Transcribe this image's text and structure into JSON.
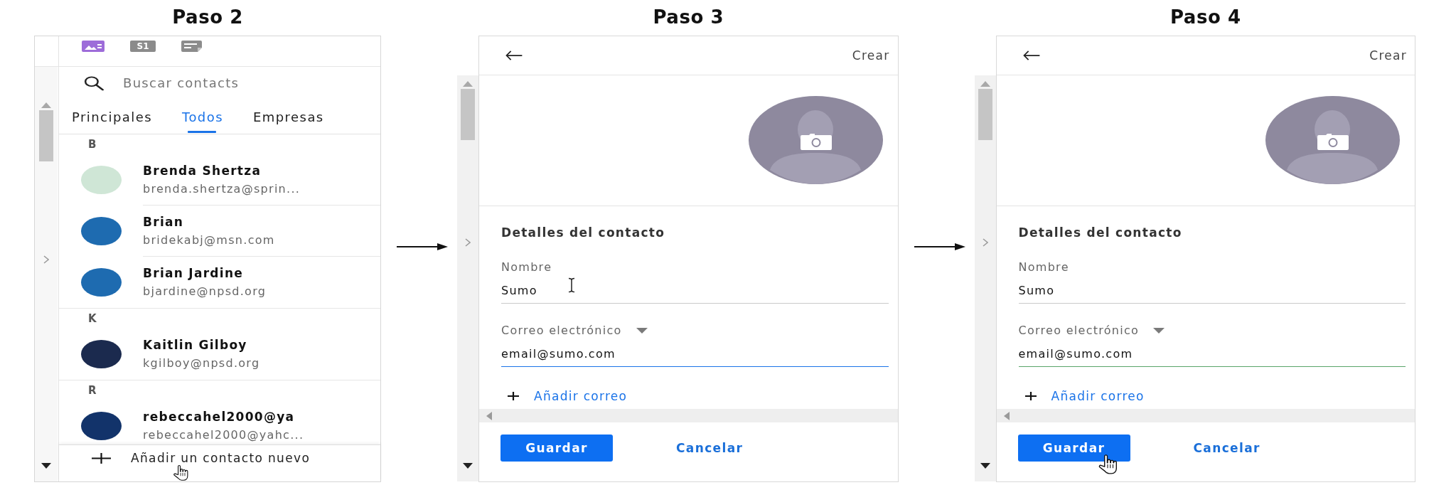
{
  "steps": [
    {
      "kind": "contacts",
      "title": "Paso 2",
      "toolbar": {
        "tile_label": "S1"
      },
      "search": {
        "placeholder": "Buscar contacts"
      },
      "tabs": [
        {
          "label": "Principales",
          "selected": false
        },
        {
          "label": "Todos",
          "selected": true
        },
        {
          "label": "Empresas",
          "selected": false
        }
      ],
      "groups": [
        {
          "letter": "B",
          "contacts": [
            {
              "name": "Brenda Shertza",
              "email": "brenda.shertza@sprin...",
              "color": "#cfe6d6"
            },
            {
              "name": "Brian",
              "email": "bridekabj@msn.com",
              "color": "#1e6bb0"
            },
            {
              "name": "Brian Jardine",
              "email": "bjardine@npsd.org",
              "color": "#1e6bb0"
            }
          ]
        },
        {
          "letter": "K",
          "contacts": [
            {
              "name": "Kaitlin Gilboy",
              "email": "kgilboy@npsd.org",
              "color": "#1b2a4e"
            }
          ]
        },
        {
          "letter": "R",
          "contacts": [
            {
              "name": "rebeccahel2000@ya",
              "email": "rebeccahel2000@yahc...",
              "color": "#12336a"
            }
          ]
        }
      ],
      "add_contact": {
        "label": "Añadir un contacto nuevo",
        "hovered": true
      }
    },
    {
      "kind": "form",
      "title": "Paso 3",
      "header_title": "Crear",
      "section_title": "Detalles del contacto",
      "fields": [
        {
          "kind": "text",
          "label": "Nombre",
          "value": "Sumo",
          "focused": false,
          "valid": false,
          "hovered": true
        },
        {
          "kind": "email",
          "label": "Correo electrónico",
          "value": "email@sumo.com",
          "focused": true,
          "valid": false,
          "hovered": false
        }
      ],
      "add_link": "Añadir correo",
      "buttons": [
        {
          "kind": "primary",
          "label": "Guardar",
          "hovered": false
        },
        {
          "kind": "link",
          "label": "Cancelar",
          "hovered": false
        }
      ]
    },
    {
      "kind": "form",
      "title": "Paso 4",
      "header_title": "Crear",
      "section_title": "Detalles del contacto",
      "fields": [
        {
          "kind": "text",
          "label": "Nombre",
          "value": "Sumo",
          "focused": false,
          "valid": false,
          "hovered": false
        },
        {
          "kind": "email",
          "label": "Correo electrónico",
          "value": "email@sumo.com",
          "focused": false,
          "valid": true,
          "hovered": false
        }
      ],
      "add_link": "Añadir correo",
      "buttons": [
        {
          "kind": "primary",
          "label": "Guardar",
          "hovered": true
        },
        {
          "kind": "link",
          "label": "Cancelar",
          "hovered": false
        }
      ]
    }
  ]
}
